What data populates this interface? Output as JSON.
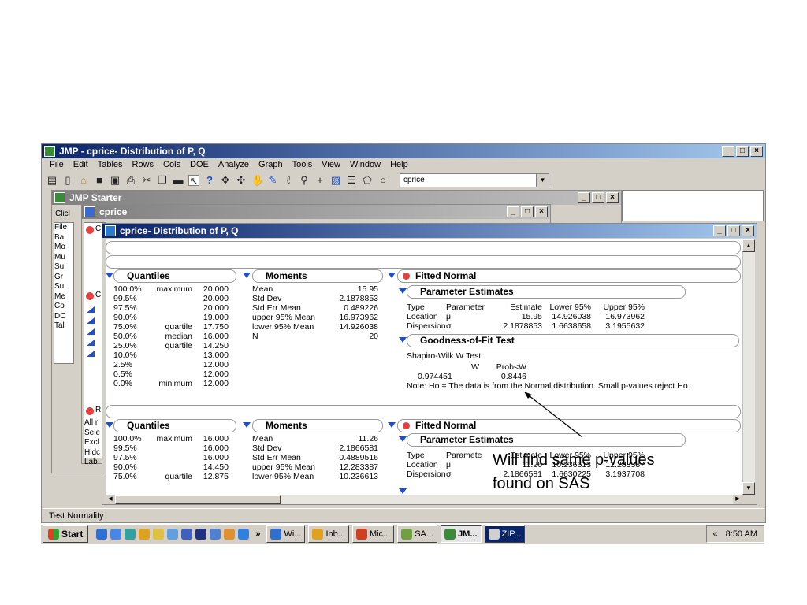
{
  "app": {
    "title": "JMP - cprice- Distribution of P, Q",
    "menu": [
      "File",
      "Edit",
      "Tables",
      "Rows",
      "Cols",
      "DOE",
      "Analyze",
      "Graph",
      "Tools",
      "View",
      "Window",
      "Help"
    ],
    "toolbar_icons": [
      "new-table-icon",
      "new-file-icon",
      "open-icon",
      "table-icon",
      "save-icon",
      "print-icon",
      "cut-icon",
      "copy-icon",
      "paste-icon",
      "arrow-icon",
      "help-icon",
      "crosshair-icon",
      "move-icon",
      "hand-icon",
      "brush-icon",
      "lasso-icon",
      "magnifier-icon",
      "plus-icon",
      "annotate-icon",
      "lines-icon",
      "polygon-icon",
      "circle-icon"
    ],
    "table_combo": "cprice"
  },
  "starter": {
    "title": "JMP Starter",
    "click_label": "Clicl"
  },
  "cprice_win": {
    "title": "cprice"
  },
  "left_list": [
    "File",
    "Ba",
    "Mo",
    "Mu",
    "Su",
    "Gr",
    "Su",
    "Me",
    "Co",
    "DC",
    "Tal"
  ],
  "left_red_labels": [
    "C",
    "R"
  ],
  "left_rows": [
    "All r",
    "Sele",
    "Excl",
    "Hidc",
    "Lab"
  ],
  "dist_win": {
    "title": "cprice- Distribution of P, Q"
  },
  "section1": {
    "quantiles_title": "Quantiles",
    "quantiles": [
      [
        "100.0%",
        "maximum",
        "20.000"
      ],
      [
        "99.5%",
        "",
        "20.000"
      ],
      [
        "97.5%",
        "",
        "20.000"
      ],
      [
        "90.0%",
        "",
        "19.000"
      ],
      [
        "75.0%",
        "quartile",
        "17.750"
      ],
      [
        "50.0%",
        "median",
        "16.000"
      ],
      [
        "25.0%",
        "quartile",
        "14.250"
      ],
      [
        "10.0%",
        "",
        "13.000"
      ],
      [
        "2.5%",
        "",
        "12.000"
      ],
      [
        "0.5%",
        "",
        "12.000"
      ],
      [
        "0.0%",
        "minimum",
        "12.000"
      ]
    ],
    "moments_title": "Moments",
    "moments": [
      [
        "Mean",
        "15.95"
      ],
      [
        "Std Dev",
        "2.1878853"
      ],
      [
        "Std Err Mean",
        "0.489226"
      ],
      [
        "upper 95% Mean",
        "16.973962"
      ],
      [
        "lower 95% Mean",
        "14.926038"
      ],
      [
        "N",
        "20"
      ]
    ],
    "fitted_title": "Fitted Normal",
    "param_title": "Parameter Estimates",
    "param_headers": [
      "Type",
      "Parameter",
      "Estimate",
      "Lower 95%",
      "Upper 95%"
    ],
    "params": [
      [
        "Location",
        "μ",
        "15.95",
        "14.926038",
        "16.973962"
      ],
      [
        "Dispersion",
        "σ",
        "2.1878853",
        "1.6638658",
        "3.1955632"
      ]
    ],
    "gof_title": "Goodness-of-Fit Test",
    "gof_test": "Shapiro-Wilk W Test",
    "gof_headers": [
      "W",
      "Prob<W"
    ],
    "gof_values": [
      "0.974451",
      "0.8446"
    ],
    "note": "Note: Ho = The data is from the Normal distribution. Small p-values reject Ho."
  },
  "section2": {
    "quantiles_title": "Quantiles",
    "quantiles": [
      [
        "100.0%",
        "maximum",
        "16.000"
      ],
      [
        "99.5%",
        "",
        "16.000"
      ],
      [
        "97.5%",
        "",
        "16.000"
      ],
      [
        "90.0%",
        "",
        "14.450"
      ],
      [
        "75.0%",
        "quartile",
        "12.875"
      ]
    ],
    "moments_title": "Moments",
    "moments": [
      [
        "Mean",
        "11.26"
      ],
      [
        "Std Dev",
        "2.1866581"
      ],
      [
        "Std Err Mean",
        "0.4889516"
      ],
      [
        "upper 95% Mean",
        "12.283387"
      ],
      [
        "lower 95% Mean",
        "10.236613"
      ]
    ],
    "fitted_title": "Fitted Normal",
    "param_title": "Parameter Estimates",
    "param_headers": [
      "Type",
      "Paramete",
      "Estimate",
      "Lower 95%",
      "Upper 95%"
    ],
    "params": [
      [
        "Location",
        "μ",
        "11.26",
        "10.236613",
        "12.283387"
      ],
      [
        "Dispersion",
        "σ",
        "2.1866581",
        "1.6630225",
        "3.1937708"
      ]
    ]
  },
  "annotation": {
    "line1": "Will find same p-values",
    "line2": "found on SAS"
  },
  "status": {
    "text": "Test Normality"
  },
  "taskbar": {
    "start": "Start",
    "chevron": "»",
    "tasks": [
      "Wi...",
      "Inb...",
      "Mic...",
      "SA...",
      "JM...",
      "ZIP..."
    ],
    "tray_chevron": "«",
    "clock": "8:50 AM"
  }
}
